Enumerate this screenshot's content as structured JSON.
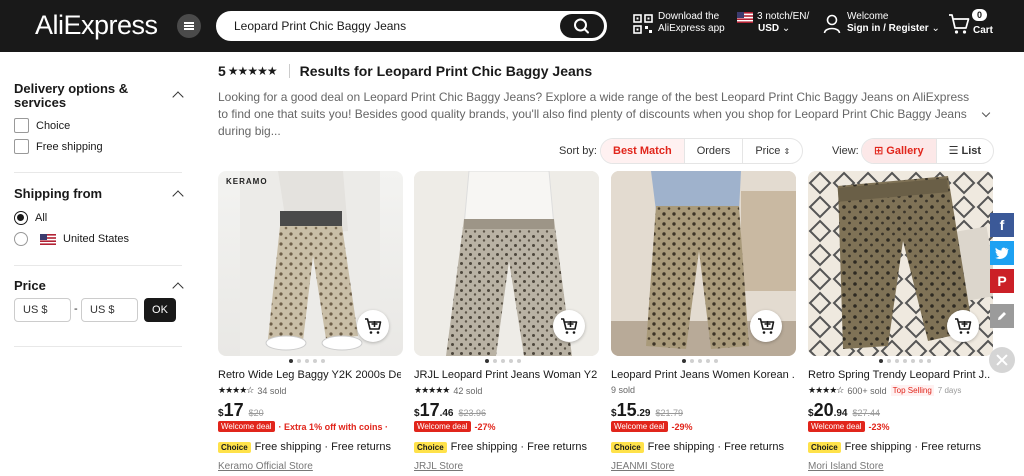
{
  "header": {
    "logo": "AliExpress",
    "search_value": "Leopard Print Chic Baggy Jeans",
    "download_line1": "Download the",
    "download_line2": "AliExpress app",
    "region_line1": "3 notch/EN/",
    "region_line2": "USD",
    "welcome_line1": "Welcome",
    "welcome_line2": "Sign in / Register",
    "cart_count": "0",
    "cart_label": "Cart"
  },
  "sidebar": {
    "delivery_title_1": "Delivery options &",
    "delivery_title_2": "services",
    "choice_label": "Choice",
    "free_shipping_label": "Free shipping",
    "ship_from_title": "Shipping from",
    "all_label": "All",
    "us_label": "United States",
    "price_title": "Price",
    "min_placeholder": "US $",
    "max_placeholder": "US $",
    "dash": "-",
    "ok_label": "OK"
  },
  "results": {
    "rating": "5",
    "stars": "★★★★★",
    "title": "Results for Leopard Print Chic Baggy Jeans",
    "description": "Looking for a good deal on Leopard Print Chic Baggy Jeans? Explore a wide range of the best Leopard Print Chic Baggy Jeans on AliExpress to find one that suits you! Besides good quality brands, you'll also find plenty of discounts when you shop for Leopard Print Chic Baggy Jeans during big..."
  },
  "sort": {
    "label": "Sort by:",
    "best_match": "Best Match",
    "orders": "Orders",
    "price": "Price"
  },
  "view": {
    "label": "View:",
    "gallery": "Gallery",
    "list": "List"
  },
  "products": [
    {
      "brand_overlay": "KERAMO",
      "title": "Retro Wide Leg Baggy Y2K 2000s De...",
      "stars": "★★★★☆",
      "sold": "34 sold",
      "currency": "$",
      "price_int": "17",
      "price_dec": "",
      "old_price": "$20",
      "deal": "Welcome deal",
      "discount": "· Extra 1% off with coins ·",
      "choice": "Choice",
      "shipping": "Free shipping · Free returns",
      "store": "Keramo Official Store"
    },
    {
      "title": "JRJL Leopard Print Jeans Woman Y2k...",
      "stars": "★★★★★",
      "sold": "42 sold",
      "currency": "$",
      "price_int": "17",
      "price_dec": ".46",
      "old_price": "$23.96",
      "deal": "Welcome deal",
      "discount": "-27%",
      "choice": "Choice",
      "shipping": "Free shipping · Free returns",
      "store": "JRJL Store"
    },
    {
      "title": "Leopard Print Jeans Women Korean ...",
      "stars": "",
      "sold": "9 sold",
      "currency": "$",
      "price_int": "15",
      "price_dec": ".29",
      "old_price": "$21.79",
      "deal": "Welcome deal",
      "discount": "-29%",
      "choice": "Choice",
      "shipping": "Free shipping · Free returns",
      "store": "JEANMI Store"
    },
    {
      "title": "Retro Spring Trendy Leopard Print J...",
      "stars": "★★★★☆",
      "sold": "600+ sold",
      "top_selling": "Top Selling",
      "days": "7 days",
      "currency": "$",
      "price_int": "20",
      "price_dec": ".94",
      "old_price": "$27.44",
      "deal": "Welcome deal",
      "discount": "-23%",
      "choice": "Choice",
      "shipping": "Free shipping · Free returns",
      "store": "Mori Island Store"
    }
  ],
  "social": {
    "facebook": "f",
    "twitter": "t",
    "pinterest": "P"
  },
  "colors": {
    "header_bg": "#191919",
    "accent_red": "#e1251b",
    "choice_yellow": "#ffe24a",
    "facebook": "#3b5998",
    "twitter": "#1da1f2",
    "pinterest": "#cb2027"
  }
}
